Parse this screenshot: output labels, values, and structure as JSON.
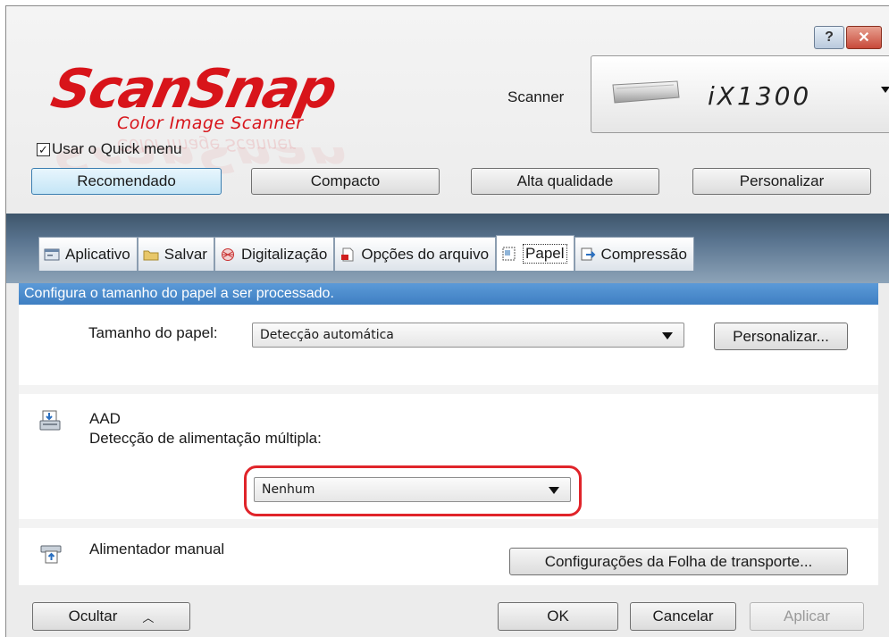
{
  "window": {
    "help_label": "?",
    "close_label": "✕"
  },
  "logo": {
    "main": "ScanSnap",
    "sub": "Color Image Scanner"
  },
  "scanner": {
    "label": "Scanner",
    "model": "iX1300"
  },
  "quick_menu": {
    "checked": true,
    "label": "Usar o Quick menu"
  },
  "profiles": [
    {
      "label": "Recomendado",
      "selected": true
    },
    {
      "label": "Compacto",
      "selected": false
    },
    {
      "label": "Alta qualidade",
      "selected": false
    },
    {
      "label": "Personalizar",
      "selected": false
    }
  ],
  "tabs": [
    {
      "label": "Aplicativo",
      "icon": "application-icon"
    },
    {
      "label": "Salvar",
      "icon": "folder-icon"
    },
    {
      "label": "Digitalização",
      "icon": "scan-icon"
    },
    {
      "label": "Opções do arquivo",
      "icon": "file-options-icon"
    },
    {
      "label": "Papel",
      "icon": "paper-icon",
      "active": true
    },
    {
      "label": "Compressão",
      "icon": "compression-icon"
    }
  ],
  "paper": {
    "description": "Configura o tamanho do papel a ser processado.",
    "size_label": "Tamanho do papel:",
    "size_value": "Detecção automática",
    "customize_button": "Personalizar..."
  },
  "adf": {
    "title": "AAD",
    "multifeed_label": "Detecção de alimentação múltipla:",
    "multifeed_value": "Nenhum"
  },
  "manual": {
    "title": "Alimentador manual",
    "carrier_button": "Configurações da Folha de transporte..."
  },
  "footer": {
    "hide_button": "Ocultar",
    "ok_button": "OK",
    "cancel_button": "Cancelar",
    "apply_button": "Aplicar"
  },
  "colors": {
    "brand_red": "#d8141a",
    "band_blue": "#5a7590",
    "desc_blue": "#4a8ccd",
    "highlight_red": "#e0242a"
  }
}
